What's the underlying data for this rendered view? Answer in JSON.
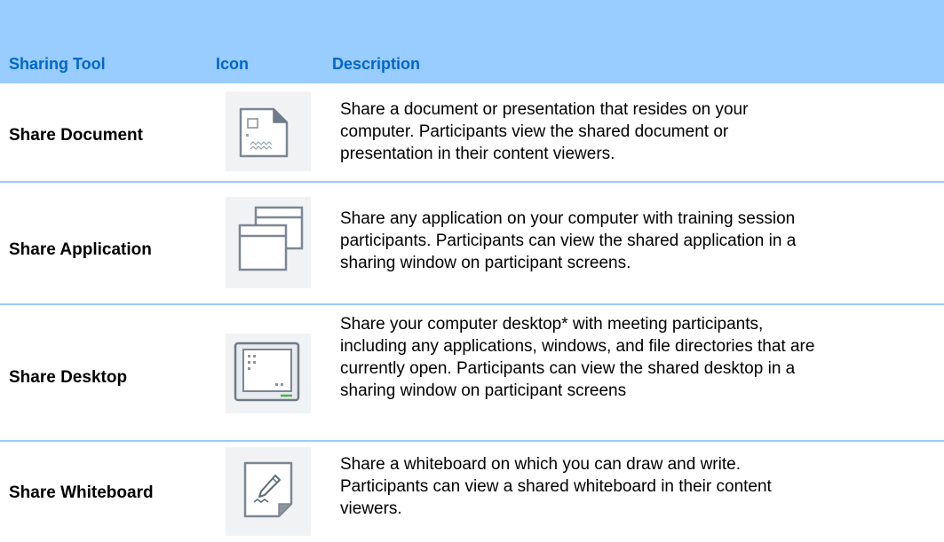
{
  "table": {
    "headers": {
      "tool": "Sharing Tool",
      "icon": "Icon",
      "description": "Description"
    },
    "rows": [
      {
        "tool": "Share Document",
        "icon": "document-icon",
        "description_lines": [
          "Share a document or presentation that resides on your",
          "computer. Participants view the shared document or",
          "presentation in their content viewers."
        ]
      },
      {
        "tool": "Share Application",
        "icon": "application-windows-icon",
        "description_lines": [
          "Share any application on your computer with training session",
          "participants. Participants can view the shared application in a",
          "sharing window on participant screens."
        ]
      },
      {
        "tool": "Share Desktop",
        "icon": "desktop-monitor-icon",
        "description_lines": [
          "Share your computer desktop* with meeting participants,",
          "including any applications, windows, and file directories that are",
          "currently open. Participants can view the shared desktop in a",
          "sharing window on participant screens"
        ]
      },
      {
        "tool": "Share Whiteboard",
        "icon": "whiteboard-pencil-icon",
        "description_lines": [
          "Share a whiteboard on which you can draw and write.",
          "Participants can view a shared whiteboard in their content",
          "viewers."
        ]
      }
    ]
  },
  "colors": {
    "header_background": "#99ccff",
    "header_text": "#0066cc",
    "row_separator": "#99ccff"
  }
}
